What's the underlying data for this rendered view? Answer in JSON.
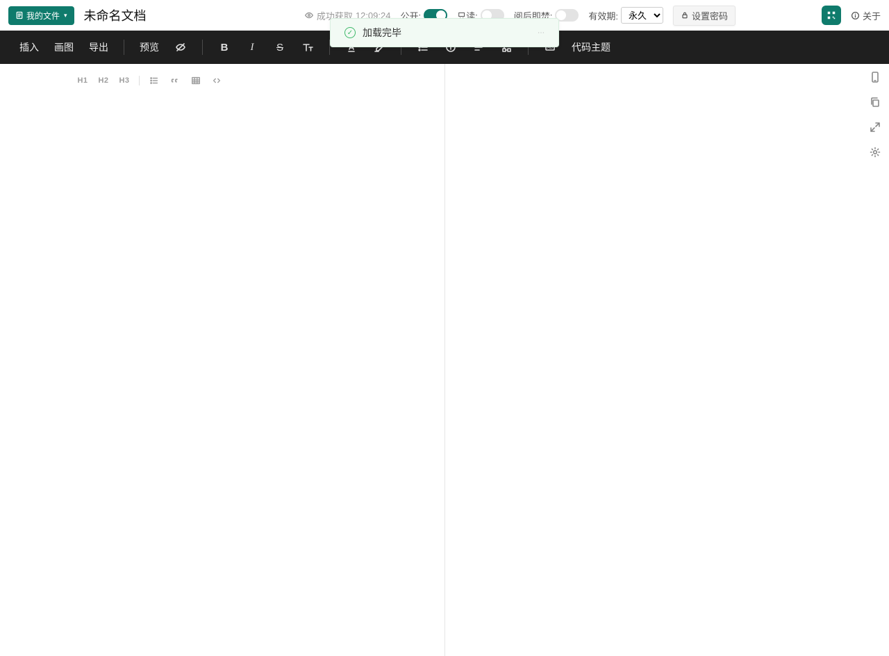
{
  "header": {
    "my_files_label": "我的文件",
    "doc_title": "未命名文档",
    "fetch_status_prefix": "成功获取",
    "fetch_time": "12:09:24",
    "toggles": {
      "public": {
        "label": "公开:",
        "on": true
      },
      "readonly": {
        "label": "只读:",
        "on": false
      },
      "burn": {
        "label": "阅后即焚:",
        "on": false
      }
    },
    "validity": {
      "label": "有效期:",
      "selected": "永久"
    },
    "set_password_label": "设置密码",
    "about_label": "关于"
  },
  "main_toolbar": {
    "insert_label": "插入",
    "draw_label": "画图",
    "export_label": "导出",
    "preview_label": "预览",
    "code_theme_label": "代码主题"
  },
  "secondary_toolbar": {
    "h1": "H1",
    "h2": "H2",
    "h3": "H3"
  },
  "notification": {
    "message": "加载完毕"
  },
  "icons": {
    "file_list": "file-list-icon",
    "chevron_down": "chevron-down-icon",
    "eye": "eye-icon",
    "lock": "lock-icon",
    "qr": "qr-icon",
    "info": "info-icon",
    "hidden": "hidden-eye-icon",
    "bold": "bold-icon",
    "italic": "italic-icon",
    "strike": "strike-icon",
    "font_size": "font-size-icon",
    "font_color": "font-color-icon",
    "highlight": "highlight-icon",
    "list": "list-icon",
    "circle_i": "circle-i-icon",
    "align": "align-icon",
    "structure": "structure-icon",
    "ab": "ab-icon",
    "bullet_list": "bullet-list-icon",
    "quote": "quote-icon",
    "table": "table-icon",
    "code": "code-icon",
    "phone": "phone-outline-icon",
    "copy": "copy-icon",
    "expand": "expand-icon",
    "gear": "gear-icon",
    "check": "check-icon",
    "close": "close-icon"
  }
}
